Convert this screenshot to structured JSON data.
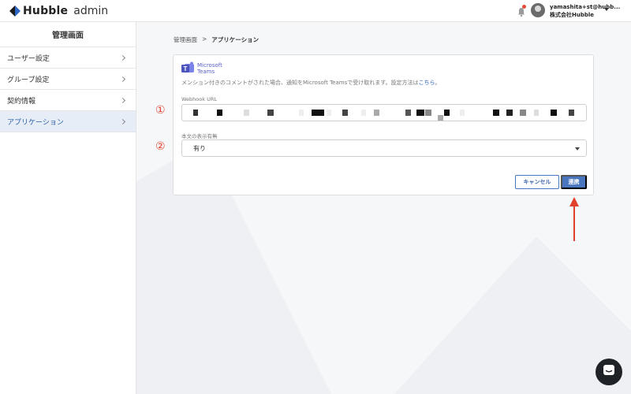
{
  "header": {
    "brand": "Hubble",
    "brand_suffix": "admin",
    "user_email": "yamashita+st@hubb...",
    "user_company": "株式会社Hubble"
  },
  "sidebar": {
    "title": "管理画面",
    "items": [
      {
        "label": "ユーザー設定"
      },
      {
        "label": "グループ設定"
      },
      {
        "label": "契約情報"
      },
      {
        "label": "アプリケーション"
      }
    ],
    "active_index": 3
  },
  "breadcrumb": {
    "root": "管理画面",
    "separator": ">",
    "current": "アプリケーション"
  },
  "card": {
    "app_name_line1": "Microsoft",
    "app_name_line2": "Teams",
    "description": "メンション付きのコメントがされた場合、通知をMicrosoft Teamsで受け取れます。設定方法は",
    "description_link": "こちら",
    "description_end": "。",
    "webhook_label": "Webhook URL",
    "webhook_value": "(masked)",
    "body_display_label": "本文の表示有無",
    "body_display_value": "有り",
    "cancel_label": "キャンセル",
    "connect_label": "連携"
  },
  "annotations": {
    "marker_1": "①",
    "marker_2": "②"
  },
  "colors": {
    "accent": "#4a76c0",
    "active_nav_bg": "#e7edf6",
    "annotation_red": "#e0412f",
    "teams_purple": "#5b5fc7"
  }
}
